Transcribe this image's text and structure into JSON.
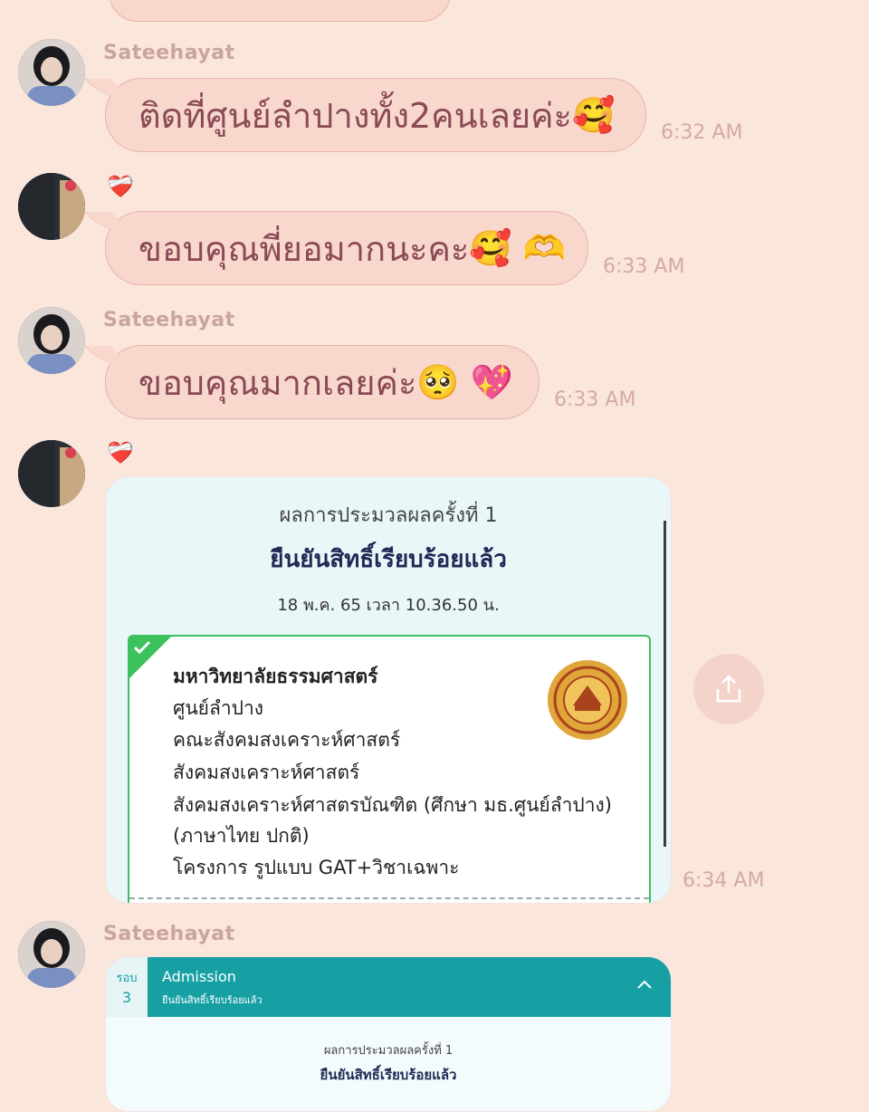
{
  "messages": [
    {
      "sender": "Sateehayat",
      "text": "ติดที่ศูนย์ลำปางทั้ง2คนเลยค่ะ",
      "emoji": "🥰",
      "time": "6:32 AM"
    },
    {
      "sender_icon": "❤️‍🩹",
      "text": "ขอบคุณพี่ยอมากนะคะ",
      "emoji": "🥰 🫶",
      "time": "6:33 AM"
    },
    {
      "sender": "Sateehayat",
      "text": "ขอบคุณมากเลยค่ะ",
      "emoji": "🥺 💖",
      "time": "6:33 AM"
    },
    {
      "sender_icon": "❤️‍🩹",
      "time": "6:34 AM"
    },
    {
      "sender": "Sateehayat"
    }
  ],
  "result_card": {
    "heading": "ผลการประมวลผลครั้งที่ 1",
    "status": "ยืนยันสิทธิ์เรียบร้อยแล้ว",
    "datetime": "18 พ.ค. 65 เวลา 10.36.50 น.",
    "university": "มหาวิทยาลัยธรรมศาสตร์",
    "lines": [
      "ศูนย์ลำปาง",
      "คณะสังคมสงเคราะห์ศาสตร์",
      "สังคมสงเคราะห์ศาสตร์",
      "สังคมสงเคราะห์ศาสตรบัณฑิต (ศึกษา มธ.ศูนย์ลำปาง)",
      "(ภาษาไทย ปกติ)",
      "โครงการ รูปแบบ GAT+วิชาเฉพาะ"
    ]
  },
  "admission_card": {
    "round_label": "รอบ",
    "round_num": "3",
    "title": "Admission",
    "subtitle": "ยืนยันสิทธิ์เรียบร้อยแล้ว",
    "heading": "ผลการประมวลผลครั้งที่ 1",
    "status": "ยืนยันสิทธิ์เรียบร้อยแล้ว"
  },
  "icons": {
    "share": "share-icon",
    "chevron": "chevron-up-icon",
    "check": "check-icon"
  },
  "colors": {
    "background": "#fbe6dc",
    "bubble": "#f8d7cd",
    "bubble_text": "#8a4a55",
    "accent_green": "#3cc25c",
    "teal": "#16a0a4"
  }
}
